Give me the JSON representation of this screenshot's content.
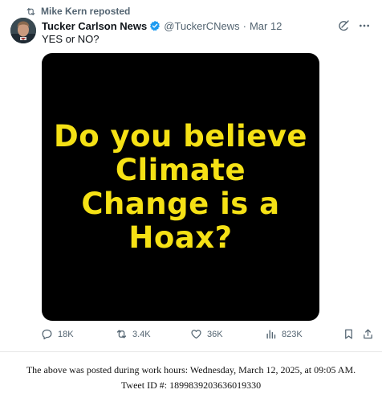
{
  "repost": {
    "text": "Mike Kern reposted"
  },
  "author": {
    "name": "Tucker Carlson News",
    "handle": "@TuckerCNews",
    "separator": "·",
    "date": "Mar 12"
  },
  "tweet": {
    "text": "YES or NO?",
    "image_lines": [
      "Do you believe",
      "Climate",
      "Change is a",
      "Hoax?"
    ]
  },
  "actions": {
    "replies": "18K",
    "reposts": "3.4K",
    "likes": "36K",
    "views": "823K"
  },
  "icons": {
    "repost": "repost-icon",
    "verified": "verified-badge-icon",
    "grok": "grok-icon",
    "more": "more-icon",
    "reply": "reply-icon",
    "like": "heart-icon",
    "views": "views-chart-icon",
    "bookmark": "bookmark-icon",
    "share": "share-icon"
  },
  "colors": {
    "verified": "#1d9bf0",
    "muted": "#536471",
    "image_background": "#000000",
    "image_text": "#f5e115"
  },
  "footer": {
    "line1": "The above was posted during work hours: Wednesday, March 12, 2025, at 09:05 AM.",
    "line2": "Tweet ID #: 1899839203636019330"
  }
}
